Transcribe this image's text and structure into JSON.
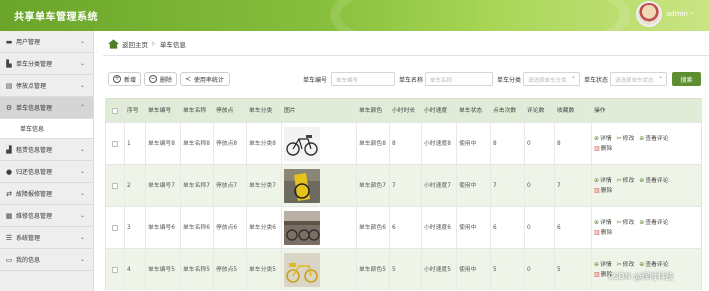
{
  "app": {
    "title": "共享单车管理系统",
    "user": "admin"
  },
  "sidebar": {
    "items": [
      {
        "label": "用户管理",
        "icon": "monitor-icon"
      },
      {
        "label": "单车分类管理",
        "icon": "chart-icon"
      },
      {
        "label": "停放点管理",
        "icon": "clipboard-icon"
      },
      {
        "label": "单车信息管理",
        "icon": "gear-icon",
        "active": true,
        "sub": "单车信息"
      },
      {
        "label": "租赁信息管理",
        "icon": "bar-chart-icon"
      },
      {
        "label": "归还信息管理",
        "icon": "location-icon"
      },
      {
        "label": "故障报修管理",
        "icon": "exchange-icon"
      },
      {
        "label": "维修信息管理",
        "icon": "grid-icon"
      },
      {
        "label": "系统管理",
        "icon": "menu-icon"
      },
      {
        "label": "我的信息",
        "icon": "window-icon"
      }
    ]
  },
  "breadcrumb": {
    "home": "返回主页",
    "current": "单车信息"
  },
  "toolbar": {
    "add": "新增",
    "delete": "删除",
    "stats": "使用率统计"
  },
  "filters": {
    "code_label": "单车编号",
    "code_placeholder": "单车编号",
    "name_label": "单车名称",
    "name_placeholder": "单车名称",
    "category_label": "单车分类",
    "category_placeholder": "请选择单车分类",
    "status_label": "单车状态",
    "status_placeholder": "请选择单车状态",
    "search": "搜索"
  },
  "table": {
    "headers": [
      "序号",
      "单车编号",
      "单车名称",
      "停放点",
      "单车分类",
      "图片",
      "单车颜色",
      "小时时长",
      "小时速度",
      "单车状态",
      "点击次数",
      "评论数",
      "收藏数",
      "操作"
    ],
    "rows": [
      {
        "idx": "1",
        "code": "单车编号8",
        "name": "单车名称8",
        "spot": "停放点8",
        "category": "单车分类8",
        "color": "单车颜色8",
        "hours": "8",
        "speed": "小时速度8",
        "status": "使用中",
        "clicks": "8",
        "comments": "0",
        "favorites": "8"
      },
      {
        "idx": "2",
        "code": "单车编号7",
        "name": "单车名称7",
        "spot": "停放点7",
        "category": "单车分类7",
        "color": "单车颜色7",
        "hours": "7",
        "speed": "小时速度7",
        "status": "使用中",
        "clicks": "7",
        "comments": "0",
        "favorites": "7"
      },
      {
        "idx": "3",
        "code": "单车编号6",
        "name": "单车名称6",
        "spot": "停放点6",
        "category": "单车分类6",
        "color": "单车颜色6",
        "hours": "6",
        "speed": "小时速度6",
        "status": "使用中",
        "clicks": "6",
        "comments": "0",
        "favorites": "6"
      },
      {
        "idx": "4",
        "code": "单车编号5",
        "name": "单车名称5",
        "spot": "停放点5",
        "category": "单车分类5",
        "color": "单车颜色5",
        "hours": "5",
        "speed": "小时速度5",
        "status": "使用中",
        "clicks": "5",
        "comments": "0",
        "favorites": "5"
      }
    ],
    "ops": {
      "detail": "详情",
      "edit": "修改",
      "reviews": "查看评论",
      "delete": "删除"
    }
  },
  "watermark": "CSDN @辉时科技",
  "colors": {
    "accent": "#5f8e32",
    "header_green": "#7ab536"
  }
}
